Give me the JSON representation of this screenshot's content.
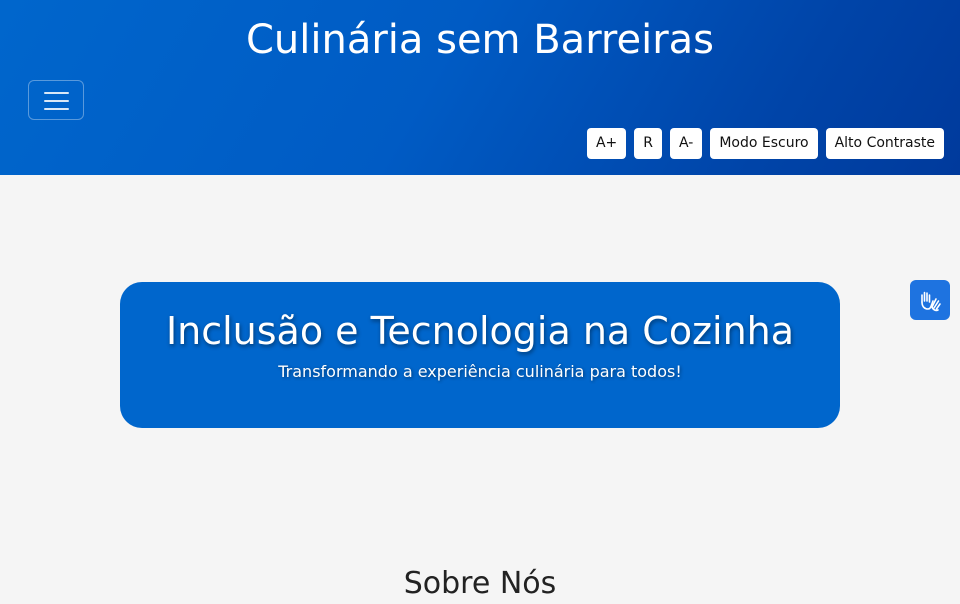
{
  "header": {
    "site_title": "Culinária sem Barreiras",
    "menu_icon": "hamburger-menu-icon",
    "background_colors": [
      "#0066cc",
      "#003a9c"
    ]
  },
  "accessibility_toolbar": {
    "increase_font_label": "A+",
    "reset_font_label": "R",
    "decrease_font_label": "A-",
    "dark_mode_label": "Modo Escuro",
    "high_contrast_label": "Alto Contraste"
  },
  "hero": {
    "title": "Inclusão e Tecnologia na Cozinha",
    "subtitle": "Transformando a experiência culinária para todos!",
    "background_color": "#0066cc"
  },
  "vlibras": {
    "icon": "sign-language-hands-icon",
    "color": "#1e73e0"
  },
  "about": {
    "heading": "Sobre Nós"
  }
}
